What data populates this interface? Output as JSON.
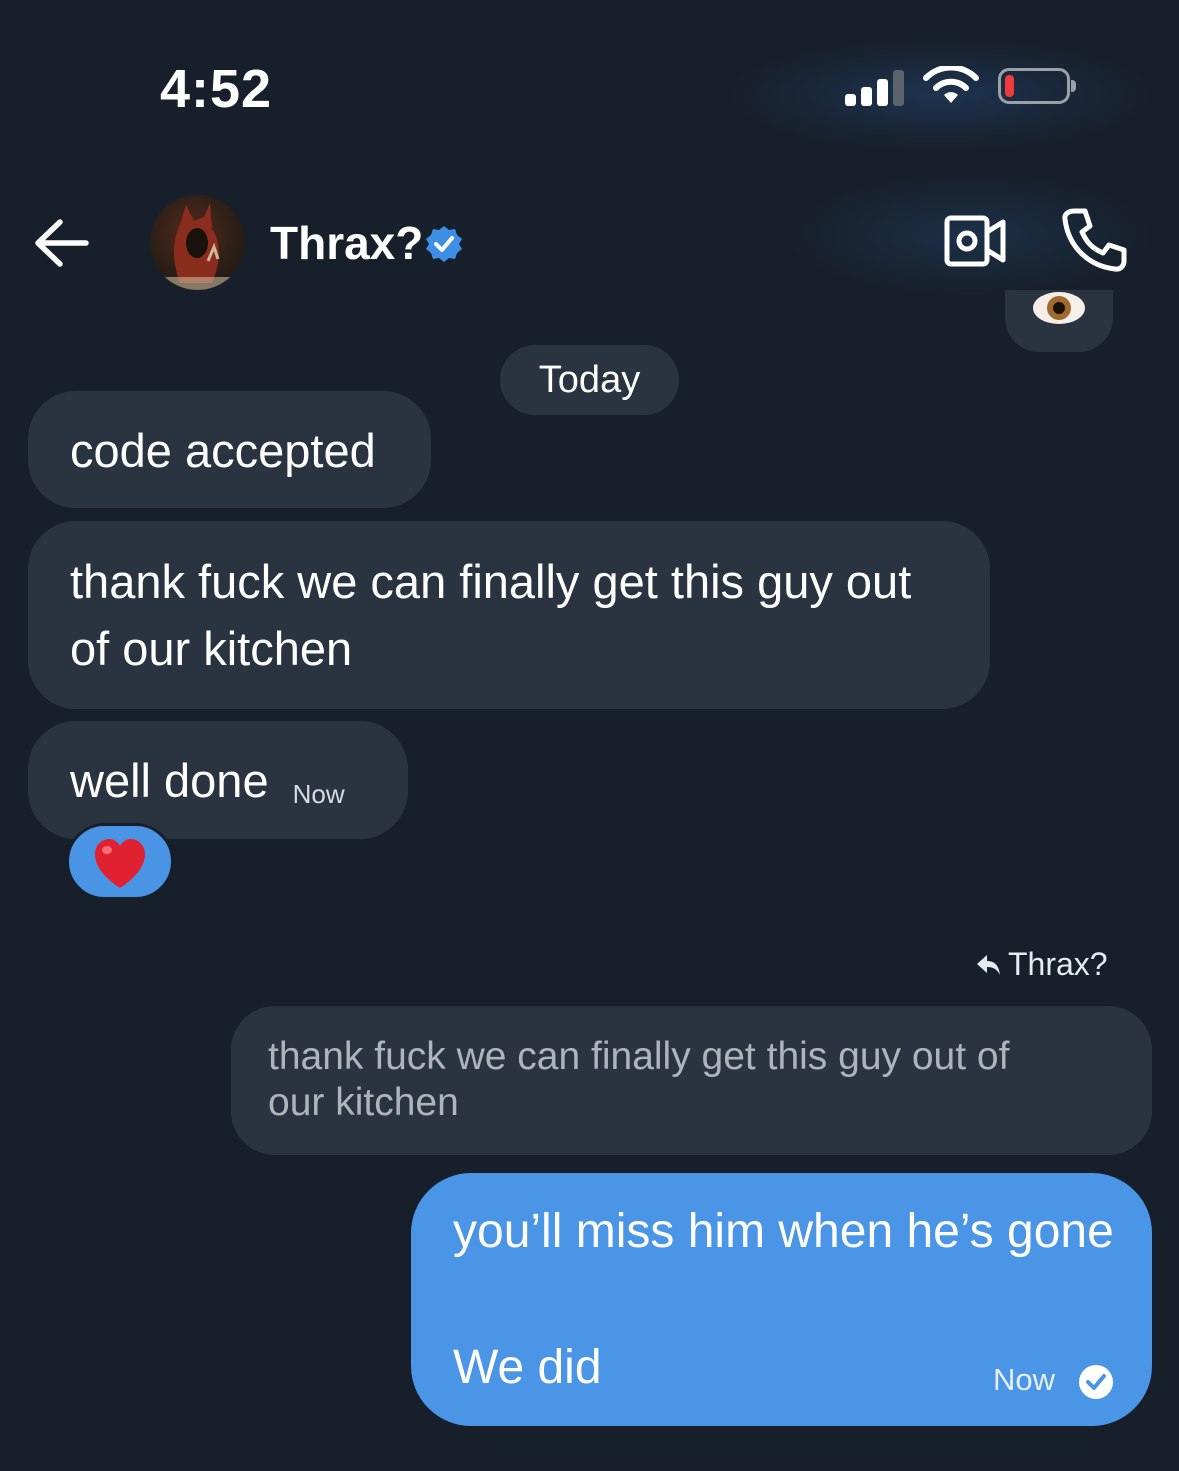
{
  "status_bar": {
    "time": "4:52"
  },
  "header": {
    "contact_name": "Thrax?"
  },
  "date_separator": "Today",
  "messages_received": [
    {
      "text": "code accepted"
    },
    {
      "text": "thank fuck we can finally get this guy out of our kitchen"
    },
    {
      "text": "well done",
      "time": "Now"
    }
  ],
  "reply": {
    "label": "Thrax?",
    "quoted_text": "thank fuck we can finally get this guy out of our kitchen",
    "line1": "you’ll miss him when he’s gone",
    "line2": "We did",
    "time": "Now"
  },
  "colors": {
    "background": "#171f2a",
    "bubble_in": "#2a3441",
    "bubble_out": "#4a95e6"
  },
  "icons": [
    "back-arrow-icon",
    "verified-badge-icon",
    "video-call-icon",
    "phone-icon",
    "heart-emoji",
    "eye-emoji",
    "sent-check-icon"
  ]
}
